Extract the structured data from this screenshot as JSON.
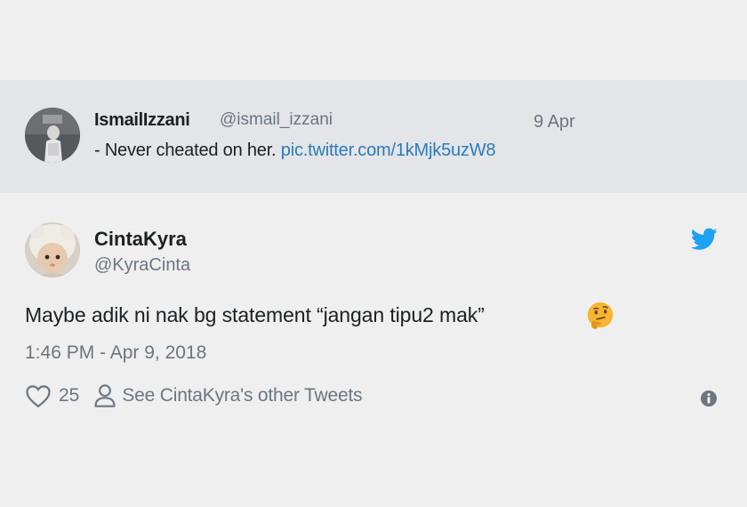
{
  "quoted_tweet": {
    "author_name": "IsmailIzzani",
    "author_handle": "@ismail_izzani",
    "date": "9 Apr",
    "text": "- Never cheated on her.",
    "link": "pic.twitter.com/1kMjk5uzW8"
  },
  "tweet": {
    "author_name": "CintaKyra",
    "author_handle": "@KyraCinta",
    "text": "Maybe adik ni nak bg statement “jangan tipu2 mak”",
    "emoji": "thinking-face",
    "timestamp": "1:46 PM - Apr 9, 2018",
    "like_count": "25",
    "other_tweets_label": "See CintaKyra's other Tweets"
  },
  "icons": {
    "brand": "twitter-bird-icon",
    "like": "heart-icon",
    "profile": "person-icon",
    "info": "info-icon"
  },
  "colors": {
    "link": "#2b7bb9",
    "twitter_blue": "#1da1f2",
    "muted": "#6b7680",
    "quoted_bg": "#e3e5e8",
    "page_bg": "#efefef"
  }
}
